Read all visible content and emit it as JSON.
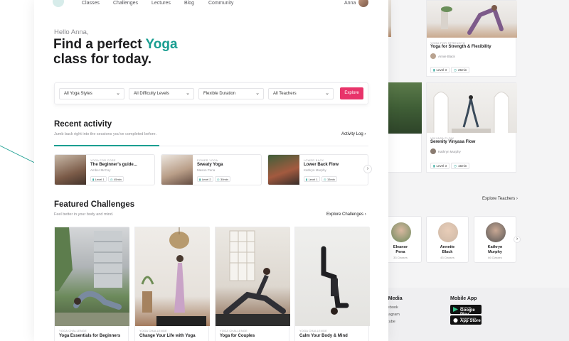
{
  "nav": {
    "items": [
      "Classes",
      "Challenges",
      "Lectures",
      "Blog",
      "Community"
    ],
    "user_name": "Anna"
  },
  "hero": {
    "greeting": "Hello Anna,",
    "headline_pre": "Find a perfect ",
    "headline_accent": "Yoga",
    "headline_post": "class for today."
  },
  "filters": {
    "style": "All Yoga Styles",
    "difficulty": "All Difficulty Levels",
    "duration": "Flexible Duration",
    "teachers": "All Teachers",
    "explore_label": "Explore"
  },
  "recent": {
    "title": "Recent activity",
    "subtitle": "Jumb back right into the sessions you've completed before.",
    "link": "Activity Log",
    "cards": [
      {
        "tag": "Yoga for Core",
        "title": "The Beginner's guide...",
        "author": "Amber McCoy",
        "level": "Level 1",
        "duration": "45min"
      },
      {
        "tag": "Power Yoga",
        "title": "Sweaty Yoga",
        "author": "Mason Pena",
        "level": "Level 2",
        "duration": "30min"
      },
      {
        "tag": "Lower Back",
        "title": "Lower Back Flow",
        "author": "Kathryn Murphy",
        "level": "Level 1",
        "duration": "15min"
      }
    ]
  },
  "challenges": {
    "title": "Featured Challenges",
    "subtitle": "Feel better in your body and mind.",
    "link": "Explore Challenges",
    "cards": [
      {
        "tag": "Yoga Challenge",
        "title": "Yoga Essentials for Beginners"
      },
      {
        "tag": "Yoga Challenge",
        "title": "Change Your Life with Yoga"
      },
      {
        "tag": "Yoga Challenge",
        "title": "Yoga for Couples"
      },
      {
        "tag": "Yoga Challenge",
        "title": "Calm Your Body & Mind"
      }
    ]
  },
  "background": {
    "card_a": {
      "tag": "Yoga for Strength",
      "title": "Yoga for Strength & Flexibility",
      "author": "Annie Black",
      "level": "Level 3",
      "duration": "25min"
    },
    "card_b_title_fragment": "on",
    "card_c": {
      "tag": "Vinyasa Flow",
      "title": "Serenity Vinyasa Flow",
      "author": "Kathryn Murphy",
      "level": "Level 3",
      "duration": "15min"
    },
    "explore_teachers": "Explore Teachers",
    "teachers": [
      {
        "name_l1": "Eleanor",
        "name_l2": "Pena",
        "classes": "33 Classes"
      },
      {
        "name_l1": "Annette",
        "name_l2": "Black",
        "classes": "43 Classes"
      },
      {
        "name_l1": "Kathryn",
        "name_l2": "Murphy",
        "classes": "66 Classes"
      }
    ],
    "footer": {
      "social_heading": "al Media",
      "social_items": [
        "cebook",
        "stagram",
        "utube"
      ],
      "mobile_heading": "Mobile App",
      "google_small": "GET IT ON",
      "google_big": "Google Play",
      "apple_small": "Download on the",
      "apple_big": "App Store"
    }
  },
  "colors": {
    "accent": "#1a9e91",
    "explore_button": "#e8346a"
  }
}
